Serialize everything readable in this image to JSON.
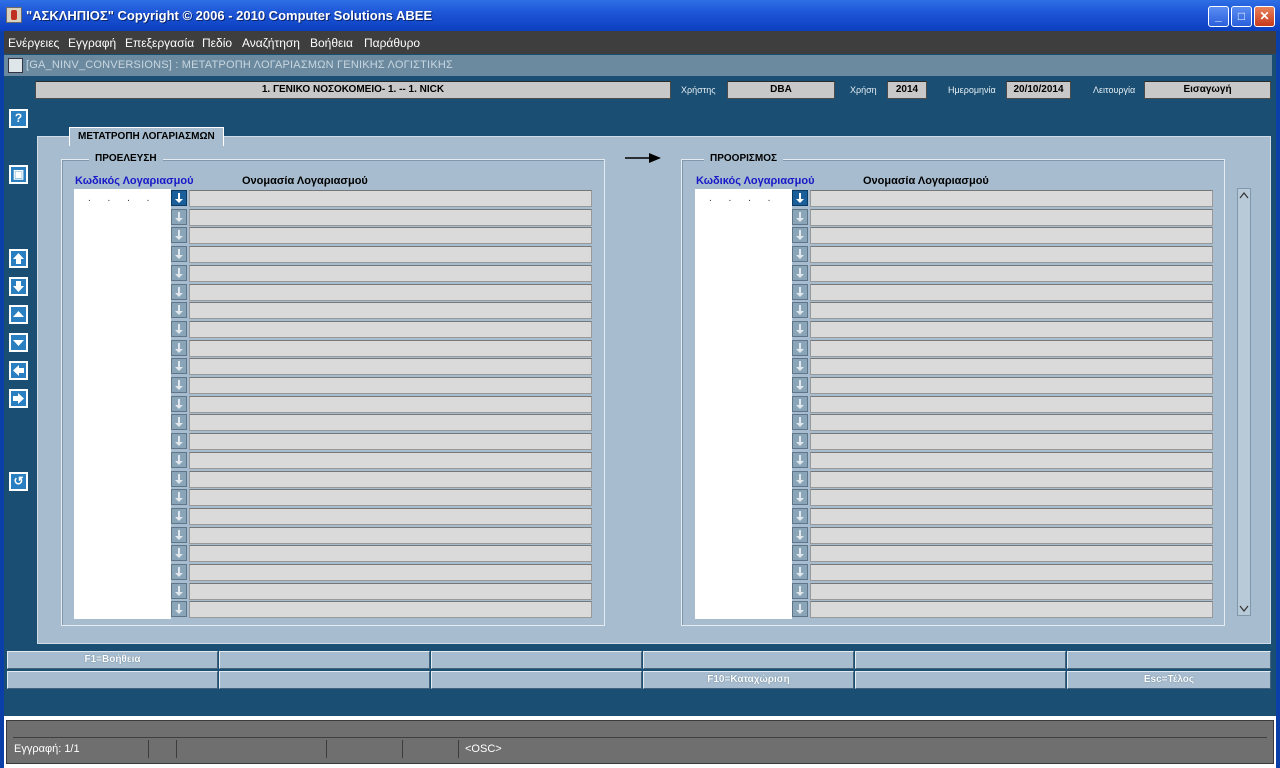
{
  "window": {
    "title": "\"ΑΣΚΛΗΠΙΟΣ\" Copyright © 2006 - 2010 Computer Solutions ABEE",
    "minimize": "_",
    "maximize": "□",
    "close": "✕"
  },
  "menu": [
    "Ενέργειες",
    "Εγγραφή",
    "Επεξεργασία",
    "Πεδίο",
    "Αναζήτηση",
    "Βοήθεια",
    "Παράθυρο"
  ],
  "document": {
    "title": "[GA_NINV_CONVERSIONS]  :  ΜΕΤΑΤΡΟΠΗ ΛΟΓΑΡΙΑΣΜΩΝ ΓΕΝΙΚΗΣ ΛΟΓΙΣΤΙΚΗΣ"
  },
  "info": {
    "company": "1. ΓΕΝΙΚΟ ΝΟΣΟΚΟΜΕΙΟ- 1. -- 1. NICK",
    "user_label": "Χρήστης",
    "user": "DBA",
    "year_label": "Χρήση",
    "year": "2014",
    "date_label": "Ημερομηνία",
    "date": "20/10/2014",
    "mode_label": "Λειτουργία",
    "mode": "Εισαγωγή"
  },
  "toolbar_icons": [
    "help-icon",
    "save-icon",
    "first-record-icon",
    "last-record-icon",
    "previous-record-icon",
    "next-record-icon",
    "previous-block-icon",
    "next-block-icon",
    "undo-icon"
  ],
  "toolbar_glyphs": {
    "help": "?",
    "save": "▣",
    "undo": "↺"
  },
  "tab": {
    "label": "ΜΕΤΑΤΡΟΠΗ ΛΟΓΑΡΙΑΣΜΩΝ"
  },
  "source": {
    "title": "ΠΡΟΕΛΕΥΣΗ",
    "col_code": "Κωδικός Λογαριασμού",
    "col_name": "Ονομασία Λογαριασμού",
    "first_code": ". . . ."
  },
  "target": {
    "title": "ΠΡΟΟΡΙΣΜΟΣ",
    "col_code": "Κωδικός Λογαριασμού",
    "col_name": "Ονομασία Λογαριασμού",
    "first_code": ". . . ."
  },
  "fkeys_row1": [
    "F1=Βοήθεια",
    "",
    "",
    "",
    "",
    ""
  ],
  "fkeys_row2": [
    "",
    "",
    "",
    "F10=Καταχώριση",
    "",
    "Esc=Τέλος"
  ],
  "status": {
    "record": "Εγγραφή: 1/1",
    "osc": "<OSC>"
  }
}
